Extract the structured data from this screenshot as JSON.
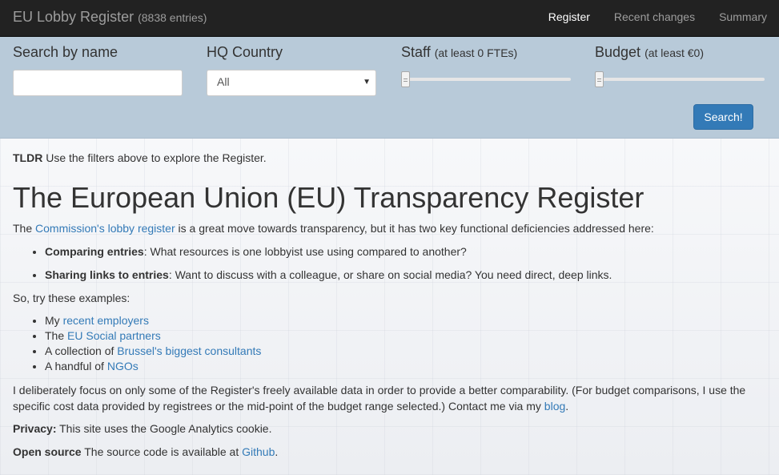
{
  "navbar": {
    "brand": "EU Lobby Register",
    "entries": "(8838 entries)",
    "links": [
      "Register",
      "Recent changes",
      "Summary"
    ]
  },
  "filters": {
    "name_label": "Search by name",
    "name_value": "",
    "country_label": "HQ Country",
    "country_selected": "All",
    "staff_label": "Staff",
    "staff_hint": "(at least 0 FTEs)",
    "staff_min": 0,
    "budget_label": "Budget",
    "budget_hint": "(at least €0)",
    "budget_min": 0,
    "search_button": "Search!"
  },
  "content": {
    "tldr_label": "TLDR",
    "tldr_text": " Use the filters above to explore the Register.",
    "heading": "The European Union (EU) Transparency Register",
    "intro_pre": "The ",
    "intro_link": "Commission's lobby register",
    "intro_post": " is a great move towards transparency, but it has two key functional deficiencies addressed here:",
    "key1_bold": "Comparing entries",
    "key1_text": ": What resources is one lobbyist use using compared to another?",
    "key2_bold": "Sharing links to entries",
    "key2_text": ": Want to discuss with a colleague, or share on social media? You need direct, deep links.",
    "try_text": "So, try these examples:",
    "ex1_pre": "My ",
    "ex1_link": "recent employers",
    "ex2_pre": "The ",
    "ex2_link": "EU Social partners",
    "ex3_pre": "A collection of ",
    "ex3_link": "Brussel's biggest consultants",
    "ex4_pre": "A handful of ",
    "ex4_link": "NGOs",
    "focus_text": "I deliberately focus on only some of the Register's freely available data in order to provide a better comparability. (For budget comparisons, I use the specific cost data provided by registrees or the mid-point of the budget range selected.) Contact me via my ",
    "focus_link": "blog",
    "focus_end": ".",
    "privacy_label": "Privacy:",
    "privacy_text": " This site uses the Google Analytics cookie.",
    "opensrc_label": "Open source",
    "opensrc_text": " The source code is available at ",
    "opensrc_link": "Github",
    "opensrc_end": "."
  }
}
